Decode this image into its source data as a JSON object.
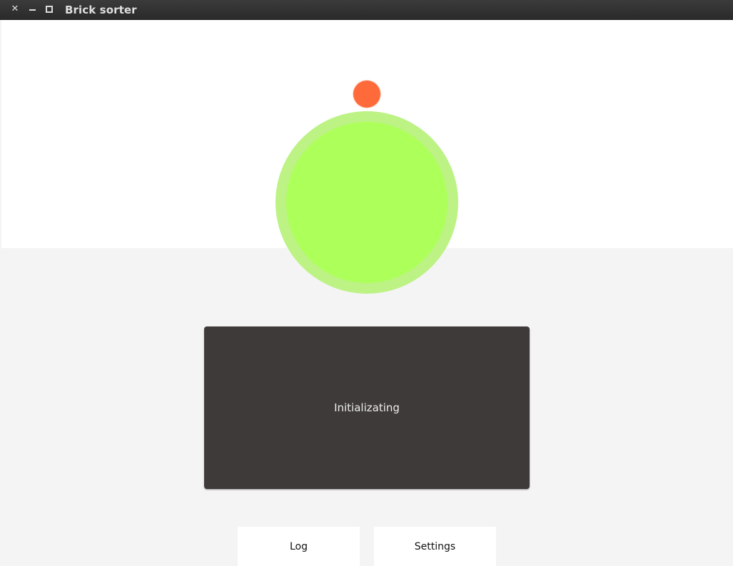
{
  "window": {
    "title": "Brick sorter",
    "controls": [
      "close-icon",
      "minimize-icon",
      "maximize-icon"
    ]
  },
  "status": {
    "indicator_color": "#ff6a3b",
    "ring_color": "#bdf285",
    "core_color": "#adff5a",
    "message": "Initializating"
  },
  "nav": {
    "log_label": "Log",
    "settings_label": "Settings"
  }
}
